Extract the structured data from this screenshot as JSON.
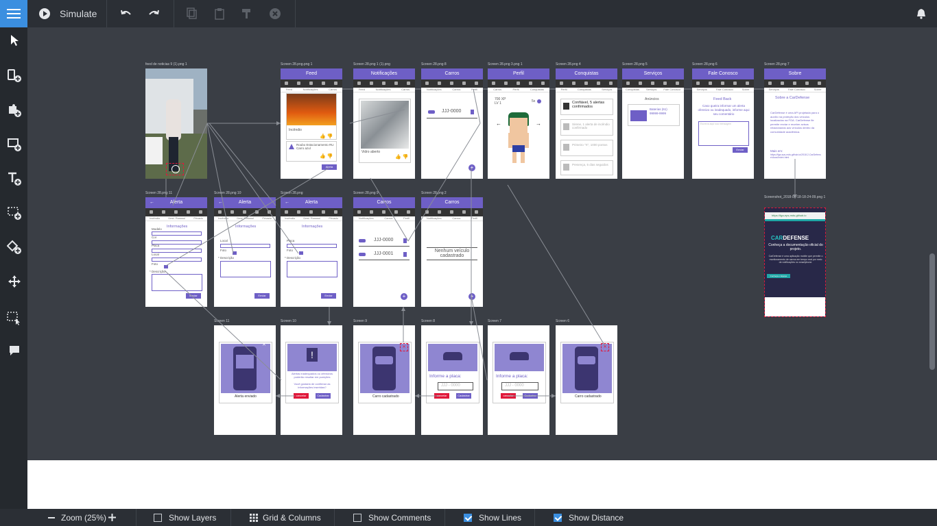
{
  "toolbar": {
    "simulate_label": "Simulate"
  },
  "artboards": {
    "news": {
      "label": "feed de noticias 9 (1).png 1"
    },
    "feed": {
      "label": "Screen 28.png.png 1",
      "title": "Feed",
      "tabs": [
        "Feed",
        "Notificações",
        "Carros"
      ],
      "item1": "Incêndio",
      "item2": "Roubo Estacionamento RU Carro azul",
      "button": "Alerta"
    },
    "notif": {
      "label": "Screen 28.png 1 (1).png",
      "title": "Notificações",
      "tabs": [
        "Feed",
        "Notificações",
        "Carros"
      ],
      "item": "Vidro aberto"
    },
    "cars1": {
      "label": "Screen 28.png 8",
      "title": "Carros",
      "tabs": [
        "Notificações",
        "Carros",
        "Perfil"
      ],
      "plate": "JJJ-0000"
    },
    "profile": {
      "label": "Screen 28.png 3.png 1",
      "title": "Perfil",
      "tabs": [
        "Carros",
        "Perfil",
        "Conquistas"
      ],
      "xp": "700 XP",
      "lv": "LV 1",
      "likes": "5x"
    },
    "achievements": {
      "label": "Screen 28.png 4",
      "title": "Conquistas",
      "tabs": [
        "Perfil",
        "Conquistas",
        "Serviços"
      ],
      "items": [
        "Confiável, 5 alertas confirmados",
        "Sirene, 1 alerta de incêndio confirmado",
        "Primeiro \"X\", 1000 pontos",
        "Presença, 5 dias seguidos"
      ]
    },
    "services": {
      "label": "Screen 28.png 5",
      "title": "Serviços",
      "tabs": [
        "Conquistas",
        "Serviços",
        "Fale Conosco"
      ],
      "heading": "Anúncios",
      "item": "Baterias (61) 99999-9999"
    },
    "contact": {
      "label": "Screen 28.png 6",
      "title": "Fale Conosco",
      "tabs": [
        "Serviços",
        "Fale Conosco",
        "Sobre"
      ],
      "heading": "Feed Back",
      "text": "Caso queira informar um alerta ofensivo ou inadequado, informe aqui seu comentário",
      "placeholder": "Escreva aqui sua mensagem",
      "button": "Enviar"
    },
    "about": {
      "label": "Screen 28.png 7",
      "title": "Sobre",
      "tabs": [
        "Serviços",
        "Fale Conosco",
        "Sobre"
      ],
      "heading": "Sobre a CarDefense",
      "text": "CarDefense é uma API projetada para o auxílio na proteção dos veículos localizados na FGA. CarDefense fle permite enviar e receber avisos relacionados aos veículos dentro da comunidade acadêmica.",
      "more": "Mais em:",
      "link": "https://fga-eps-mds.github.io/2018.2-CarDefense/docs/index.html"
    },
    "alert1": {
      "label": "Screen 28.png 11",
      "title": "Alerta",
      "tabs": [
        "Incêndio",
        "Dest. Rosssul",
        "Privado"
      ],
      "heading": "Informações",
      "fields": [
        "Modelo",
        "Cor",
        "Placa",
        "Local",
        "Foto"
      ],
      "desc_label": "* Descrição",
      "button": "Enviar"
    },
    "alert2": {
      "label": "Screen 28.png 10",
      "title": "Alerta",
      "tabs": [
        "Incêndio",
        "Dest. Rosssul",
        "Privado"
      ],
      "heading": "Informações",
      "fields": [
        "Local",
        "Foto"
      ],
      "desc_label": "* Descrição",
      "button": "Enviar"
    },
    "alert3": {
      "label": "Screen 28.png",
      "title": "Alerta",
      "tabs": [
        "Incêndio",
        "Dest. Rosssul",
        "Privado"
      ],
      "heading": "Informações",
      "fields": [
        "Placa",
        "Foto"
      ],
      "desc_label": "* Descrição",
      "button": "Enviar"
    },
    "cars2": {
      "label": "Screen 28.png 9",
      "title": "Carros",
      "tabs": [
        "Notificações",
        "Carros",
        "Perfil"
      ],
      "plates": [
        "JJJ-0000",
        "JJJ-0001"
      ]
    },
    "cars3": {
      "label": "Screen 28.png 2",
      "title": "Carros",
      "tabs": [
        "Notificações",
        "Carros",
        "Perfil"
      ],
      "empty": "Nenhum veículo cadastrado"
    },
    "screenshot": {
      "label": "Screenshot_2018-09-18-18-24-09.png 1",
      "url": "https://fga-eps-mds.github.io",
      "brand_car": "CAR",
      "brand_defense": "DEFENSE",
      "tagline": "Conheça a documentação oficial do projeto.",
      "desc": "CarDefense é uma aplicação mobile que permite o monitoramento de carros em tempo real por meio de notificações no smartphone.",
      "cta": "Conheça o Equipe"
    },
    "s11": {
      "label": "Screen 11",
      "caption": "Alerta enviado"
    },
    "s10": {
      "label": "Screen 10",
      "msg": "Alertas inadequados ou ofensivos poderão resultar em punições",
      "confirm": "Você gostaria de confirmar as informações inseridas?",
      "cancel": "cancelar",
      "ok": "Cadastrar"
    },
    "s9": {
      "label": "Screen 9",
      "caption": "Carro cadastrado"
    },
    "s8": {
      "label": "Screen 8",
      "prompt": "Informe a placa:",
      "placeholder": "JJJ - 0000",
      "cancel": "cancelar",
      "ok": "Cadastrar"
    },
    "s7": {
      "label": "Screen 7",
      "prompt": "Informe a placa:",
      "placeholder": "JJJ - 0000",
      "cancel": "cancelar",
      "ok": "Cadastrar"
    },
    "s6": {
      "label": "Screen 6",
      "caption": "Carro cadastrado"
    }
  },
  "bottombar": {
    "zoom_label": "Zoom (25%)",
    "show_layers": "Show Layers",
    "grid_columns": "Grid & Columns",
    "show_comments": "Show Comments",
    "show_lines": "Show Lines",
    "show_distance": "Show Distance"
  },
  "colors": {
    "accent": "#6e5fc6",
    "toolbar": "#2b2f35",
    "canvas": "#3a3e45",
    "blue": "#3b8fe0"
  }
}
